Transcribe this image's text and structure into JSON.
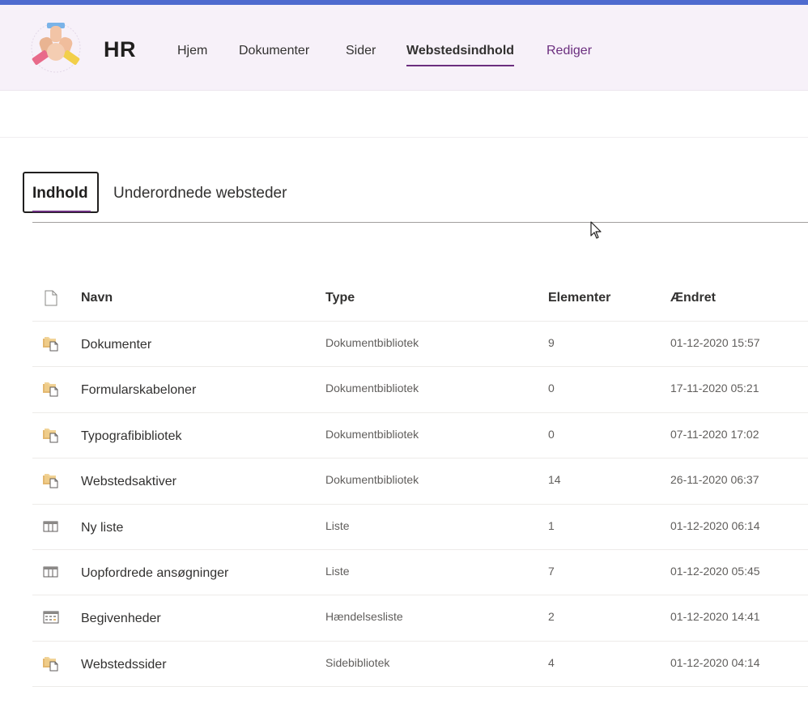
{
  "site": {
    "title": "HR",
    "logo_icon": "hr-site-logo-icon"
  },
  "nav": {
    "items": [
      {
        "label": "Hjem"
      },
      {
        "label": "Dokumenter"
      },
      {
        "label": "Sider"
      },
      {
        "label": "Webstedsindhold"
      },
      {
        "label": "Rediger"
      }
    ],
    "active": "Webstedsindhold"
  },
  "tabs": {
    "selected": "Indhold",
    "other": "Underordnede websteder"
  },
  "table": {
    "headers": {
      "icon": "file-icon",
      "name": "Navn",
      "type": "Type",
      "count": "Elementer",
      "modified": "Ændret"
    },
    "rows": [
      {
        "icon": "library-icon",
        "name": "Dokumenter",
        "type": "Dokumentbibliotek",
        "count": "9",
        "modified": "01-12-2020 15:57"
      },
      {
        "icon": "library-icon",
        "name": "Formularskabeloner",
        "type": "Dokumentbibliotek",
        "count": "0",
        "modified": "17-11-2020 05:21"
      },
      {
        "icon": "library-icon",
        "name": "Typografibibliotek",
        "type": "Dokumentbibliotek",
        "count": "0",
        "modified": "07-11-2020 17:02"
      },
      {
        "icon": "library-icon",
        "name": "Webstedsaktiver",
        "type": "Dokumentbibliotek",
        "count": "14",
        "modified": "26-11-2020 06:37"
      },
      {
        "icon": "list-icon",
        "name": "Ny liste",
        "type": "Liste",
        "count": "1",
        "modified": "01-12-2020 06:14"
      },
      {
        "icon": "list-icon",
        "name": "Uopfordrede ansøgninger",
        "type": "Liste",
        "count": "7",
        "modified": "01-12-2020 05:45"
      },
      {
        "icon": "calendar-icon",
        "name": "Begivenheder",
        "type": "Hændelsesliste",
        "count": "2",
        "modified": "01-12-2020 14:41"
      },
      {
        "icon": "library-icon",
        "name": "Webstedssider",
        "type": "Sidebibliotek",
        "count": "4",
        "modified": "01-12-2020 04:14"
      }
    ]
  },
  "colors": {
    "accent": "#6b2e7f",
    "top_bar": "#4f6bcf",
    "header_bg": "#f7f1f9"
  }
}
